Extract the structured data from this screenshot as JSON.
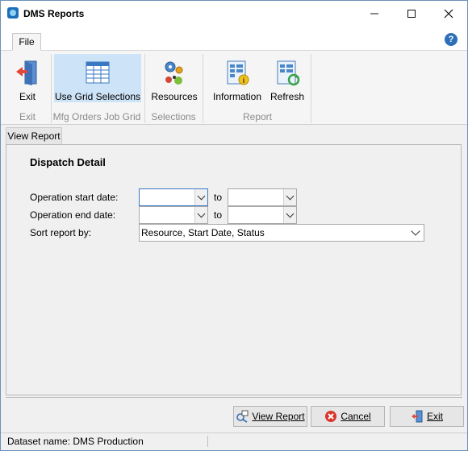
{
  "window": {
    "title": "DMS Reports"
  },
  "ribbon": {
    "tabs": [
      {
        "label": "File"
      }
    ],
    "buttons": {
      "exit": "Exit",
      "use_grid": "Use Grid Selections",
      "resources": "Resources",
      "information": "Information",
      "refresh": "Refresh"
    },
    "groups": {
      "exit": "Exit",
      "mfg": "Mfg Orders Job Grid",
      "selections": "Selections",
      "report": "Report"
    }
  },
  "tabs": {
    "view_report": "View Report"
  },
  "form": {
    "heading": "Dispatch Detail",
    "op_start_label": "Operation start date:",
    "op_end_label": "Operation end date:",
    "sort_label": "Sort report by:",
    "to_label": "to",
    "sort_value": "Resource, Start Date, Status"
  },
  "buttons": {
    "view_report": "View Report",
    "cancel": "Cancel",
    "exit": "Exit"
  },
  "status": {
    "dataset_label": "Dataset name:",
    "dataset_value": "DMS Production"
  }
}
